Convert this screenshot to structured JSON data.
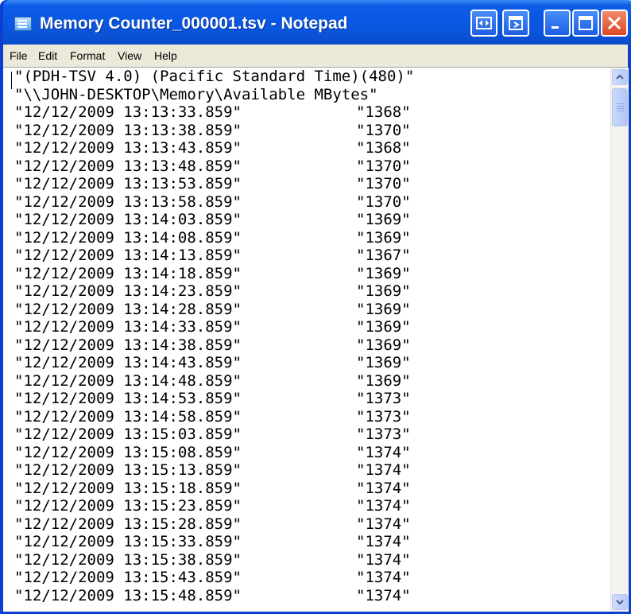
{
  "window": {
    "title": "Memory Counter_000001.tsv - Notepad",
    "colors": {
      "titlebar": "#0a55dc",
      "close_button": "#dc4a26",
      "menubar": "#ece9d8"
    }
  },
  "menu": {
    "items": [
      {
        "label": "File"
      },
      {
        "label": "Edit"
      },
      {
        "label": "Format"
      },
      {
        "label": "View"
      },
      {
        "label": "Help"
      }
    ]
  },
  "document": {
    "header_lines": [
      "\"(PDH-TSV 4.0) (Pacific Standard Time)(480)\"",
      "\"\\\\JOHN-DESKTOP\\Memory\\Available MBytes\""
    ],
    "rows": [
      {
        "timestamp": "\"12/12/2009 13:13:33.859\"",
        "value": "\"1368\""
      },
      {
        "timestamp": "\"12/12/2009 13:13:38.859\"",
        "value": "\"1370\""
      },
      {
        "timestamp": "\"12/12/2009 13:13:43.859\"",
        "value": "\"1368\""
      },
      {
        "timestamp": "\"12/12/2009 13:13:48.859\"",
        "value": "\"1370\""
      },
      {
        "timestamp": "\"12/12/2009 13:13:53.859\"",
        "value": "\"1370\""
      },
      {
        "timestamp": "\"12/12/2009 13:13:58.859\"",
        "value": "\"1370\""
      },
      {
        "timestamp": "\"12/12/2009 13:14:03.859\"",
        "value": "\"1369\""
      },
      {
        "timestamp": "\"12/12/2009 13:14:08.859\"",
        "value": "\"1369\""
      },
      {
        "timestamp": "\"12/12/2009 13:14:13.859\"",
        "value": "\"1367\""
      },
      {
        "timestamp": "\"12/12/2009 13:14:18.859\"",
        "value": "\"1369\""
      },
      {
        "timestamp": "\"12/12/2009 13:14:23.859\"",
        "value": "\"1369\""
      },
      {
        "timestamp": "\"12/12/2009 13:14:28.859\"",
        "value": "\"1369\""
      },
      {
        "timestamp": "\"12/12/2009 13:14:33.859\"",
        "value": "\"1369\""
      },
      {
        "timestamp": "\"12/12/2009 13:14:38.859\"",
        "value": "\"1369\""
      },
      {
        "timestamp": "\"12/12/2009 13:14:43.859\"",
        "value": "\"1369\""
      },
      {
        "timestamp": "\"12/12/2009 13:14:48.859\"",
        "value": "\"1369\""
      },
      {
        "timestamp": "\"12/12/2009 13:14:53.859\"",
        "value": "\"1373\""
      },
      {
        "timestamp": "\"12/12/2009 13:14:58.859\"",
        "value": "\"1373\""
      },
      {
        "timestamp": "\"12/12/2009 13:15:03.859\"",
        "value": "\"1373\""
      },
      {
        "timestamp": "\"12/12/2009 13:15:08.859\"",
        "value": "\"1374\""
      },
      {
        "timestamp": "\"12/12/2009 13:15:13.859\"",
        "value": "\"1374\""
      },
      {
        "timestamp": "\"12/12/2009 13:15:18.859\"",
        "value": "\"1374\""
      },
      {
        "timestamp": "\"12/12/2009 13:15:23.859\"",
        "value": "\"1374\""
      },
      {
        "timestamp": "\"12/12/2009 13:15:28.859\"",
        "value": "\"1374\""
      },
      {
        "timestamp": "\"12/12/2009 13:15:33.859\"",
        "value": "\"1374\""
      },
      {
        "timestamp": "\"12/12/2009 13:15:38.859\"",
        "value": "\"1374\""
      },
      {
        "timestamp": "\"12/12/2009 13:15:43.859\"",
        "value": "\"1374\""
      },
      {
        "timestamp": "\"12/12/2009 13:15:48.859\"",
        "value": "\"1374\""
      }
    ]
  },
  "icons": {
    "app": "notepad-icon",
    "titlebar_buttons": [
      "restore-split-icon",
      "maximize-alt-icon",
      "minimize-icon",
      "maximize-icon",
      "close-icon"
    ],
    "scrollbar": [
      "scroll-up-arrow-icon",
      "scroll-down-arrow-icon"
    ]
  }
}
